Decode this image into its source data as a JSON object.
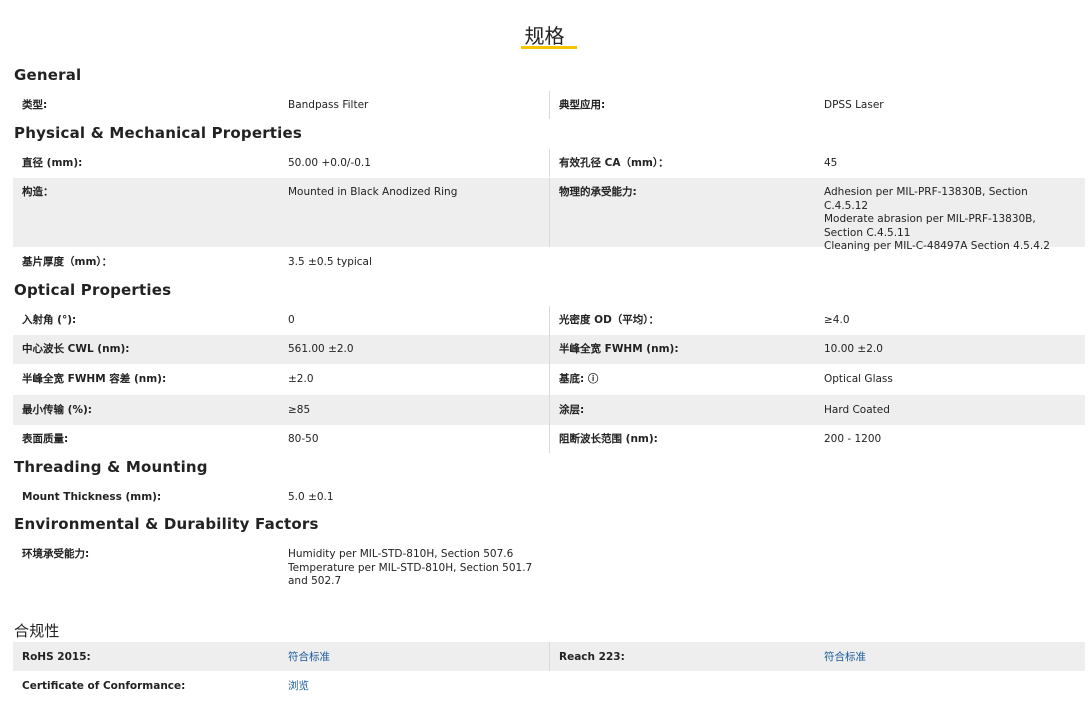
{
  "page_title": "规格",
  "sections": {
    "general": "General",
    "physical": "Physical & Mechanical Properties",
    "optical": "Optical Properties",
    "threading": "Threading & Mounting",
    "environmental": "Environmental & Durability Factors",
    "compliance": "合规性"
  },
  "general": {
    "type_label": "类型:",
    "type_value": "Bandpass Filter",
    "app_label": "典型应用:",
    "app_value": "DPSS Laser"
  },
  "physical": {
    "diameter_label": "直径 (mm):",
    "diameter_value": "50.00 +0.0/-0.1",
    "ca_label": "有效孔径 CA（mm）：",
    "ca_value": "45",
    "construction_label": "构造：",
    "construction_value": "Mounted in Black Anodized Ring",
    "durability_label": "物理的承受能力:",
    "durability_values": [
      "Adhesion per MIL-PRF-13830B, Section C.4.5.12",
      "Moderate abrasion per MIL-PRF-13830B, Section C.4.5.11",
      "Cleaning per MIL-C-48497A Section 4.5.4.2"
    ],
    "thickness_label": "基片厚度（mm）：",
    "thickness_value": "3.5 ±0.5 typical"
  },
  "optical": {
    "aoi_label": "入射角 (°):",
    "aoi_value": "0",
    "od_label": "光密度 OD（平均）：",
    "od_value": "≥4.0",
    "cwl_label": "中心波长 CWL (nm):",
    "cwl_value": "561.00 ±2.0",
    "fwhm_label": "半峰全宽 FWHM (nm):",
    "fwhm_value": "10.00 ±2.0",
    "fwhm_tol_label": "半峰全宽 FWHM 容差 (nm):",
    "fwhm_tol_value": "±2.0",
    "substrate_label": "基底: ⓘ",
    "substrate_value": "Optical Glass",
    "trans_label": "最小传输 (%):",
    "trans_value": "≥85",
    "coating_label": "涂层:",
    "coating_value": "Hard Coated",
    "surface_label": "表面质量:",
    "surface_value": "80-50",
    "blocking_label": "阻断波长范围 (nm):",
    "blocking_value": "200 - 1200"
  },
  "threading": {
    "mount_label": "Mount Thickness (mm):",
    "mount_value": "5.0 ±0.1"
  },
  "environmental": {
    "env_label": "环境承受能力:",
    "env_values": [
      "Humidity per MIL-STD-810H, Section 507.6",
      "Temperature per MIL-STD-810H, Section 501.7 and 502.7"
    ]
  },
  "compliance": {
    "rohs_label": "RoHS 2015:",
    "rohs_value": "符合标准",
    "reach_label": "Reach 223:",
    "reach_value": "符合标准",
    "coc_label": "Certificate of Conformance:",
    "coc_value": "浏览"
  },
  "colors": {
    "accent": "#f7c400",
    "link": "#1a5a9c",
    "shade": "#eeeeee"
  }
}
